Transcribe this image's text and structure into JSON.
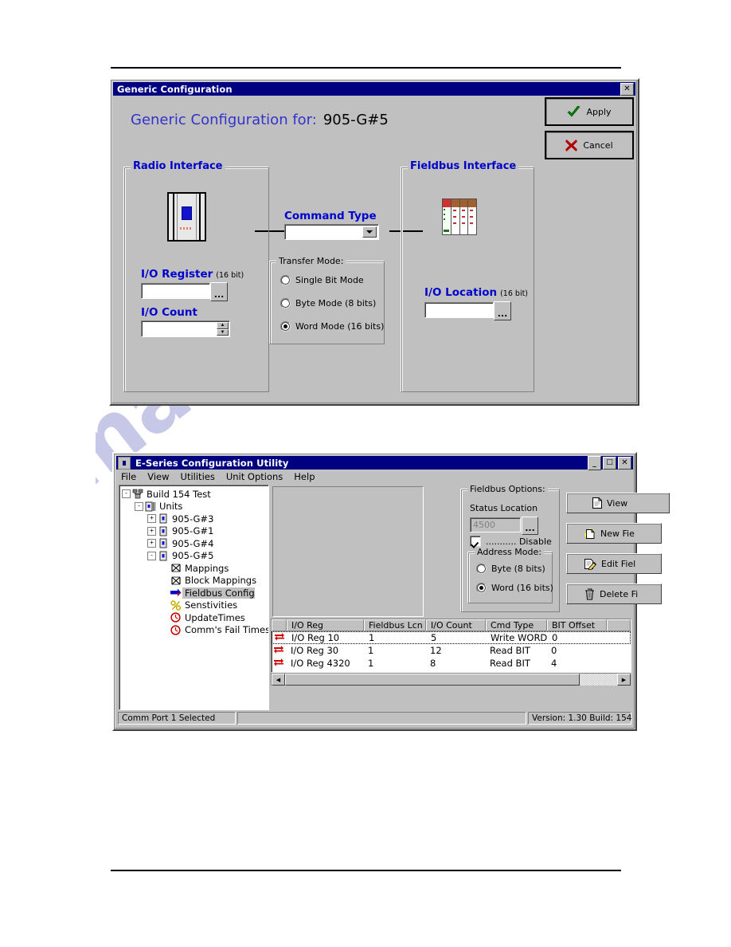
{
  "page": {
    "watermark_text": "manualslive.com"
  },
  "dialog": {
    "title": "Generic Configuration",
    "close_label": "✕",
    "heading_prefix": "Generic Configuration for:",
    "heading_value": "905-G#5",
    "buttons": {
      "apply": "Apply",
      "cancel": "Cancel"
    },
    "radio_interface": {
      "legend": "Radio Interface",
      "io_register_label": "I/O Register",
      "io_register_unit": "(16 bit)",
      "io_register_value": "",
      "io_register_browse": "...",
      "io_count_label": "I/O Count",
      "io_count_value": ""
    },
    "command_type": {
      "label": "Command Type",
      "value": ""
    },
    "transfer_mode": {
      "legend": "Transfer Mode:",
      "options": [
        {
          "label": "Single Bit Mode",
          "selected": false
        },
        {
          "label": "Byte Mode   (8 bits)",
          "selected": false
        },
        {
          "label": "Word Mode (16 bits)",
          "selected": true
        }
      ]
    },
    "fieldbus_interface": {
      "legend": "Fieldbus Interface",
      "io_location_label": "I/O Location",
      "io_location_unit": "(16 bit)",
      "io_location_value": "",
      "io_location_browse": "..."
    }
  },
  "app": {
    "title": "E-Series Configuration Utility",
    "window_buttons": {
      "minimize": "_",
      "maximize": "□",
      "close": "✕"
    },
    "menu": [
      "File",
      "View",
      "Utilities",
      "Unit Options",
      "Help"
    ],
    "tree": [
      {
        "label": "Build 154 Test",
        "depth": 0,
        "toggle": "-",
        "icon": "network-icon",
        "selected": false
      },
      {
        "label": "Units",
        "depth": 1,
        "toggle": "-",
        "icon": "unit-folder-icon",
        "selected": false
      },
      {
        "label": "905-G#3",
        "depth": 2,
        "toggle": "+",
        "icon": "unit-icon",
        "selected": false
      },
      {
        "label": "905-G#1",
        "depth": 2,
        "toggle": "+",
        "icon": "unit-icon",
        "selected": false
      },
      {
        "label": "905-G#4",
        "depth": 2,
        "toggle": "+",
        "icon": "unit-icon",
        "selected": false
      },
      {
        "label": "905-G#5",
        "depth": 2,
        "toggle": "-",
        "icon": "unit-icon",
        "selected": false
      },
      {
        "label": "Mappings",
        "depth": 3,
        "toggle": "",
        "icon": "mappings-icon",
        "selected": false
      },
      {
        "label": "Block Mappings",
        "depth": 3,
        "toggle": "",
        "icon": "mappings-icon",
        "selected": false
      },
      {
        "label": "Fieldbus Config",
        "depth": 3,
        "toggle": "",
        "icon": "arrow-icon",
        "selected": true
      },
      {
        "label": "Senstivities",
        "depth": 3,
        "toggle": "",
        "icon": "percent-icon",
        "selected": false
      },
      {
        "label": "UpdateTimes",
        "depth": 3,
        "toggle": "",
        "icon": "clock-icon",
        "selected": false
      },
      {
        "label": "Comm's Fail Times",
        "depth": 3,
        "toggle": "",
        "icon": "clock-icon",
        "selected": false
      }
    ],
    "fieldbus_options": {
      "legend": "Fieldbus Options:",
      "status_location_label": "Status Location",
      "status_location_value": "4500",
      "status_location_browse": "...",
      "disable_label": "........... Disable",
      "disable_checked": true,
      "address_mode": {
        "legend": "Address Mode:",
        "options": [
          {
            "label": "Byte (8 bits)",
            "selected": false
          },
          {
            "label": "Word (16 bits)",
            "selected": true
          }
        ]
      }
    },
    "action_buttons": [
      {
        "label": "View",
        "icon": "document-icon"
      },
      {
        "label": "New Fie",
        "icon": "new-document-icon"
      },
      {
        "label": "Edit Fiel",
        "icon": "edit-document-icon"
      },
      {
        "label": "Delete Fi",
        "icon": "trash-icon"
      }
    ],
    "table": {
      "columns": [
        "I/O Reg",
        "Fieldbus Lcn",
        "I/O Count",
        "Cmd Type",
        "BIT Offset"
      ],
      "rows": [
        {
          "io_reg": "I/O Reg 10",
          "fieldbus_lcn": "1",
          "io_count": "5",
          "cmd_type": "Write WORD",
          "bit_offset": "0"
        },
        {
          "io_reg": "I/O Reg 30",
          "fieldbus_lcn": "1",
          "io_count": "12",
          "cmd_type": "Read BIT",
          "bit_offset": "0"
        },
        {
          "io_reg": "I/O Reg 4320",
          "fieldbus_lcn": "1",
          "io_count": "8",
          "cmd_type": "Read BIT",
          "bit_offset": "4"
        }
      ]
    },
    "statusbar": {
      "left": "Comm Port 1 Selected",
      "middle": "",
      "right": "Version: 1.30 Build: 154"
    }
  }
}
